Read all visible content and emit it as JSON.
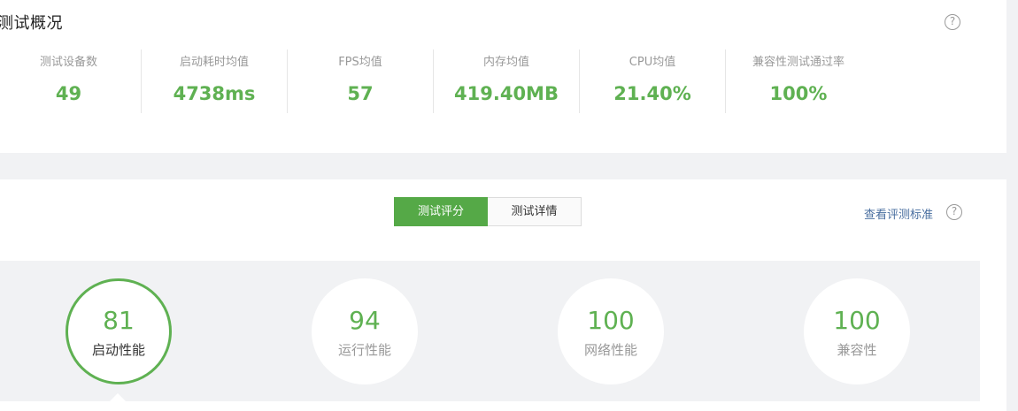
{
  "overview": {
    "title": "测试概况",
    "help_icon": "?",
    "stats": [
      {
        "label": "测试设备数",
        "value": "49"
      },
      {
        "label": "启动耗时均值",
        "value": "4738ms"
      },
      {
        "label": "FPS均值",
        "value": "57"
      },
      {
        "label": "内存均值",
        "value": "419.40MB"
      },
      {
        "label": "CPU均值",
        "value": "21.40%"
      },
      {
        "label": "兼容性测试通过率",
        "value": "100%"
      }
    ]
  },
  "scores": {
    "tabs": {
      "score_label": "测试评分",
      "detail_label": "测试详情"
    },
    "criteria_link": "查看评测标准",
    "help_icon": "?",
    "items": [
      {
        "score": "81",
        "label": "启动性能"
      },
      {
        "score": "94",
        "label": "运行性能"
      },
      {
        "score": "100",
        "label": "网络性能"
      },
      {
        "score": "100",
        "label": "兼容性"
      }
    ]
  },
  "colors": {
    "accent": "#5fb152",
    "active_tab": "#55a947",
    "link": "#4a6fa0",
    "background": "#f1f2f4"
  }
}
